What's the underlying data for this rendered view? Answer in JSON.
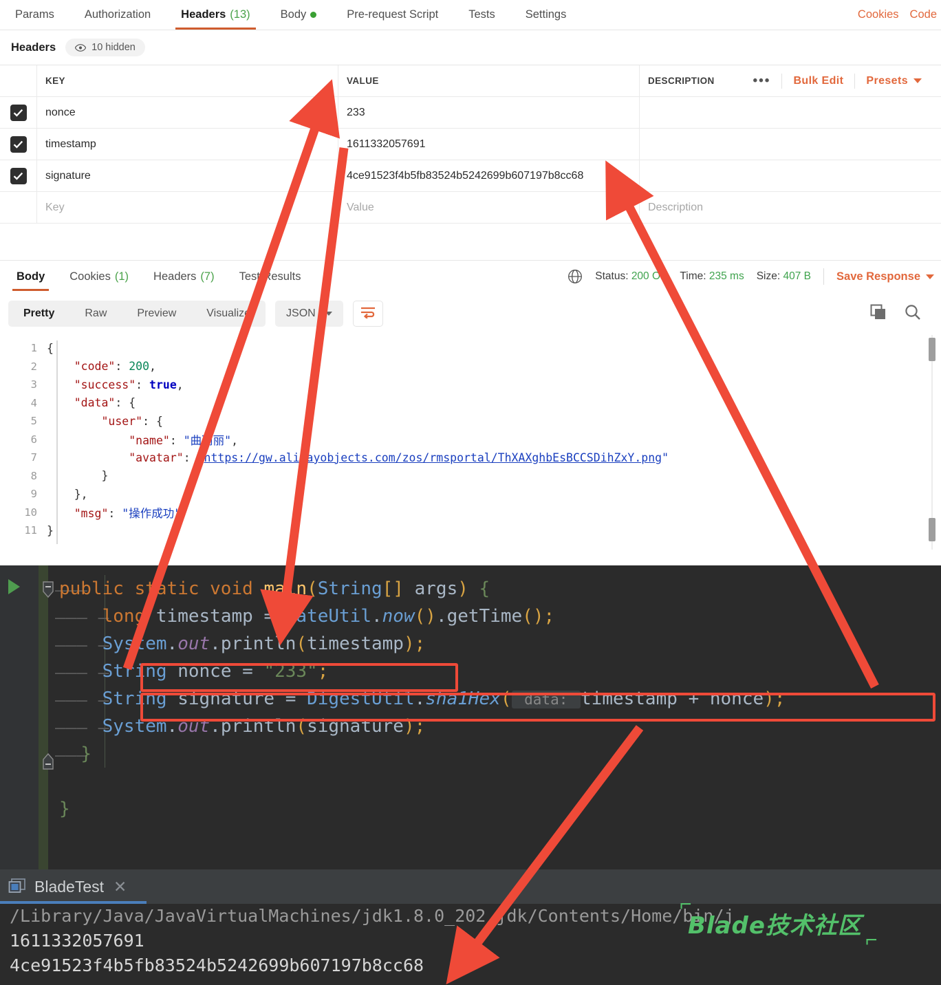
{
  "request_tabs": [
    {
      "label": "Params",
      "active": false
    },
    {
      "label": "Authorization",
      "active": false
    },
    {
      "label": "Headers",
      "count": "(13)",
      "active": true
    },
    {
      "label": "Body",
      "dot": true,
      "active": false
    },
    {
      "label": "Pre-request Script",
      "active": false
    },
    {
      "label": "Tests",
      "active": false
    },
    {
      "label": "Settings",
      "active": false
    }
  ],
  "tabbar_right": {
    "cookies": "Cookies",
    "code": "Code"
  },
  "headers_section": {
    "label": "Headers",
    "hidden_pill": "10 hidden",
    "hidden_icon": "eye-icon"
  },
  "kv_table": {
    "columns": {
      "key": "KEY",
      "value": "VALUE",
      "description": "DESCRIPTION"
    },
    "tools": {
      "dots": "•••",
      "bulk_edit": "Bulk Edit",
      "presets": "Presets"
    },
    "rows": [
      {
        "checked": true,
        "key": "nonce",
        "value": "233",
        "description": ""
      },
      {
        "checked": true,
        "key": "timestamp",
        "value": "1611332057691",
        "description": ""
      },
      {
        "checked": true,
        "key": "signature",
        "value": "4ce91523f4b5fb83524b5242699b607197b8cc68",
        "description": ""
      }
    ],
    "placeholder_row": {
      "key": "Key",
      "value": "Value",
      "description": "Description"
    }
  },
  "response_tabs": [
    {
      "label": "Body",
      "active": true
    },
    {
      "label": "Cookies",
      "count": "(1)",
      "active": false
    },
    {
      "label": "Headers",
      "count": "(7)",
      "active": false
    },
    {
      "label": "Test Results",
      "active": false
    }
  ],
  "response_meta": {
    "globe_icon": "globe-icon",
    "status_label": "Status:",
    "status_value": "200 OK",
    "time_label": "Time:",
    "time_value": "235 ms",
    "size_label": "Size:",
    "size_value": "407 B",
    "save_response": "Save Response"
  },
  "body_toolbar": {
    "modes": [
      {
        "label": "Pretty",
        "active": true
      },
      {
        "label": "Raw",
        "active": false
      },
      {
        "label": "Preview",
        "active": false
      },
      {
        "label": "Visualize",
        "active": false
      }
    ],
    "format": "JSON",
    "wrap_icon": "wrap-lines-icon",
    "copy_icon": "copy-icon",
    "search_icon": "search-icon"
  },
  "json_body": {
    "lines": [
      {
        "n": "1",
        "segments": [
          {
            "t": "{",
            "c": "p"
          }
        ]
      },
      {
        "n": "2",
        "segments": [
          {
            "t": "    ",
            "c": "p"
          },
          {
            "t": "\"code\"",
            "c": "k"
          },
          {
            "t": ": ",
            "c": "p"
          },
          {
            "t": "200",
            "c": "n"
          },
          {
            "t": ",",
            "c": "p"
          }
        ]
      },
      {
        "n": "3",
        "segments": [
          {
            "t": "    ",
            "c": "p"
          },
          {
            "t": "\"success\"",
            "c": "k"
          },
          {
            "t": ": ",
            "c": "p"
          },
          {
            "t": "true",
            "c": "b"
          },
          {
            "t": ",",
            "c": "p"
          }
        ]
      },
      {
        "n": "4",
        "segments": [
          {
            "t": "    ",
            "c": "p"
          },
          {
            "t": "\"data\"",
            "c": "k"
          },
          {
            "t": ": {",
            "c": "p"
          }
        ]
      },
      {
        "n": "5",
        "segments": [
          {
            "t": "        ",
            "c": "p"
          },
          {
            "t": "\"user\"",
            "c": "k"
          },
          {
            "t": ": {",
            "c": "p"
          }
        ]
      },
      {
        "n": "6",
        "segments": [
          {
            "t": "            ",
            "c": "p"
          },
          {
            "t": "\"name\"",
            "c": "k"
          },
          {
            "t": ": ",
            "c": "p"
          },
          {
            "t": "\"曲丽丽\"",
            "c": "s"
          },
          {
            "t": ",",
            "c": "p"
          }
        ]
      },
      {
        "n": "7",
        "segments": [
          {
            "t": "            ",
            "c": "p"
          },
          {
            "t": "\"avatar\"",
            "c": "k"
          },
          {
            "t": ": ",
            "c": "p"
          },
          {
            "t": "\"",
            "c": "s"
          },
          {
            "t": "https://gw.alipayobjects.com/zos/rmsportal/ThXAXghbEsBCCSDihZxY.png",
            "c": "u"
          },
          {
            "t": "\"",
            "c": "s"
          }
        ]
      },
      {
        "n": "8",
        "segments": [
          {
            "t": "        }",
            "c": "p"
          }
        ]
      },
      {
        "n": "9",
        "segments": [
          {
            "t": "    },",
            "c": "p"
          }
        ]
      },
      {
        "n": "10",
        "segments": [
          {
            "t": "    ",
            "c": "p"
          },
          {
            "t": "\"msg\"",
            "c": "k"
          },
          {
            "t": ": ",
            "c": "p"
          },
          {
            "t": "\"操作成功\"",
            "c": "s"
          }
        ]
      },
      {
        "n": "11",
        "segments": [
          {
            "t": "}",
            "c": "p"
          }
        ]
      }
    ]
  },
  "ide_code": {
    "lines": [
      {
        "segments": [
          {
            "t": "public ",
            "c": "kw"
          },
          {
            "t": "static ",
            "c": "kw"
          },
          {
            "t": "void ",
            "c": "kw"
          },
          {
            "t": "main",
            "c": "mth"
          },
          {
            "t": "(",
            "c": "par"
          },
          {
            "t": "String",
            "c": "cls"
          },
          {
            "t": "[] ",
            "c": "par"
          },
          {
            "t": "args",
            "c": "idt"
          },
          {
            "t": ")",
            "c": "par"
          },
          {
            "t": " {",
            "c": "grn"
          }
        ]
      },
      {
        "segments": [
          {
            "t": "long ",
            "c": "kw"
          },
          {
            "t": "timestamp ",
            "c": "idt"
          },
          {
            "t": "= ",
            "c": "idt"
          },
          {
            "t": "DateUtil",
            "c": "cls"
          },
          {
            "t": ".",
            "c": "idt"
          },
          {
            "t": "now",
            "c": "itc"
          },
          {
            "t": "()",
            "c": "par"
          },
          {
            "t": ".getTime",
            "c": "idt"
          },
          {
            "t": "()",
            "c": "par"
          },
          {
            "t": ";",
            "c": "par"
          }
        ]
      },
      {
        "segments": [
          {
            "t": "System",
            "c": "cls"
          },
          {
            "t": ".",
            "c": "idt"
          },
          {
            "t": "out",
            "c": "it2"
          },
          {
            "t": ".println",
            "c": "idt"
          },
          {
            "t": "(",
            "c": "par"
          },
          {
            "t": "timestamp",
            "c": "idt"
          },
          {
            "t": ")",
            "c": "par"
          },
          {
            "t": ";",
            "c": "par"
          }
        ]
      },
      {
        "segments": [
          {
            "t": "String ",
            "c": "cls"
          },
          {
            "t": "nonce ",
            "c": "idt"
          },
          {
            "t": "= ",
            "c": "idt"
          },
          {
            "t": "\"233\"",
            "c": "str"
          },
          {
            "t": ";",
            "c": "par"
          }
        ],
        "highlight": true
      },
      {
        "segments": [
          {
            "t": "String ",
            "c": "cls"
          },
          {
            "t": "signature ",
            "c": "idt"
          },
          {
            "t": "= ",
            "c": "idt"
          },
          {
            "t": "DigestUtil",
            "c": "cls"
          },
          {
            "t": ".",
            "c": "idt"
          },
          {
            "t": "sha1Hex",
            "c": "itc"
          },
          {
            "t": "(",
            "c": "par"
          },
          {
            "t": " data: ",
            "c": "hint"
          },
          {
            "t": "timestamp ",
            "c": "idt"
          },
          {
            "t": "+ ",
            "c": "idt"
          },
          {
            "t": "nonce",
            "c": "idt"
          },
          {
            "t": ")",
            "c": "par"
          },
          {
            "t": ";",
            "c": "par"
          }
        ],
        "highlight": true
      },
      {
        "segments": [
          {
            "t": "System",
            "c": "cls"
          },
          {
            "t": ".",
            "c": "idt"
          },
          {
            "t": "out",
            "c": "it2"
          },
          {
            "t": ".println",
            "c": "idt"
          },
          {
            "t": "(",
            "c": "par"
          },
          {
            "t": "signature",
            "c": "idt"
          },
          {
            "t": ")",
            "c": "par"
          },
          {
            "t": ";",
            "c": "par"
          }
        ]
      },
      {
        "segments": [
          {
            "t": "}",
            "c": "grn"
          }
        ]
      },
      {
        "segments": [
          {
            "t": "",
            "c": "idt"
          }
        ]
      },
      {
        "segments": [
          {
            "t": "}",
            "c": "grn"
          }
        ]
      }
    ],
    "run_icon": "run-triangle-icon"
  },
  "console": {
    "tab_label": "BladeTest",
    "tab_icon": "console-window-icon",
    "close_icon": "close-icon",
    "output": [
      "/Library/Java/JavaVirtualMachines/jdk1.8.0_202.jdk/Contents/Home/bin/j",
      "1611332057691",
      "4ce91523f4b5fb83524b5242699b607197b8cc68"
    ]
  },
  "watermark": {
    "text": "Blade技术社区"
  },
  "colors": {
    "accent_orange": "#cf5c2e",
    "link_orange": "#e2683c",
    "success_green": "#3fa34d",
    "ide_bg": "#2b2b2b",
    "console_bg": "#3c3f41",
    "annotation_red": "#ef4a38",
    "watermark_green": "#53c06a"
  }
}
